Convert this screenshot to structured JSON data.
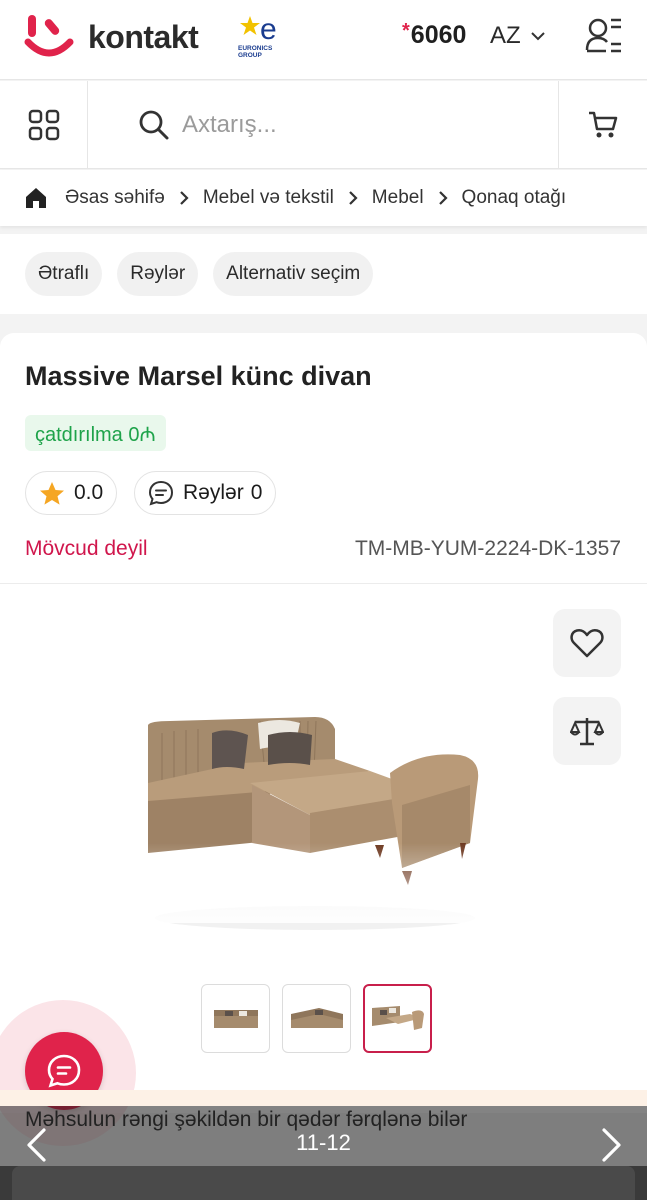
{
  "header": {
    "logo_text": "kontakt",
    "partner_logo_text": "EURONICS GROUP",
    "hotline_prefix": "*",
    "hotline_number": "6060",
    "language": "AZ"
  },
  "search": {
    "placeholder": "Axtarış..."
  },
  "breadcrumb": {
    "items": [
      "Əsas səhifə",
      "Mebel və tekstil",
      "Mebel",
      "Qonaq otağı"
    ]
  },
  "tabs": [
    "Ətraflı",
    "Rəylər",
    "Alternativ seçim"
  ],
  "product": {
    "title": "Massive Marsel künc divan",
    "delivery": "çatdırılma 0₼",
    "rating": "0.0",
    "reviews_label": "Rəylər",
    "reviews_count": "0",
    "availability": "Mövcud deyil",
    "sku": "TM-MB-YUM-2224-DK-1357",
    "thumbnail_count": 3,
    "active_thumbnail": 3,
    "color_notice": "Məhsulun rəngi şəkildən bir qədər fərqlənə bilər"
  },
  "gallery": {
    "counter": "11-12"
  },
  "colors": {
    "brand_red": "#e0234b",
    "availability_red": "#d0164c",
    "delivery_green": "#1ea34a",
    "rating_star": "#f5a623"
  },
  "icons": [
    "kontakt-logo-icon",
    "euronics-logo-icon",
    "chevron-down-icon",
    "user-menu-icon",
    "grid-menu-icon",
    "search-icon",
    "cart-icon",
    "home-icon",
    "chevron-right-icon",
    "star-icon",
    "chat-bubble-icon",
    "heart-icon",
    "compare-scale-icon",
    "chat-icon",
    "arrow-left-icon",
    "arrow-right-icon"
  ]
}
